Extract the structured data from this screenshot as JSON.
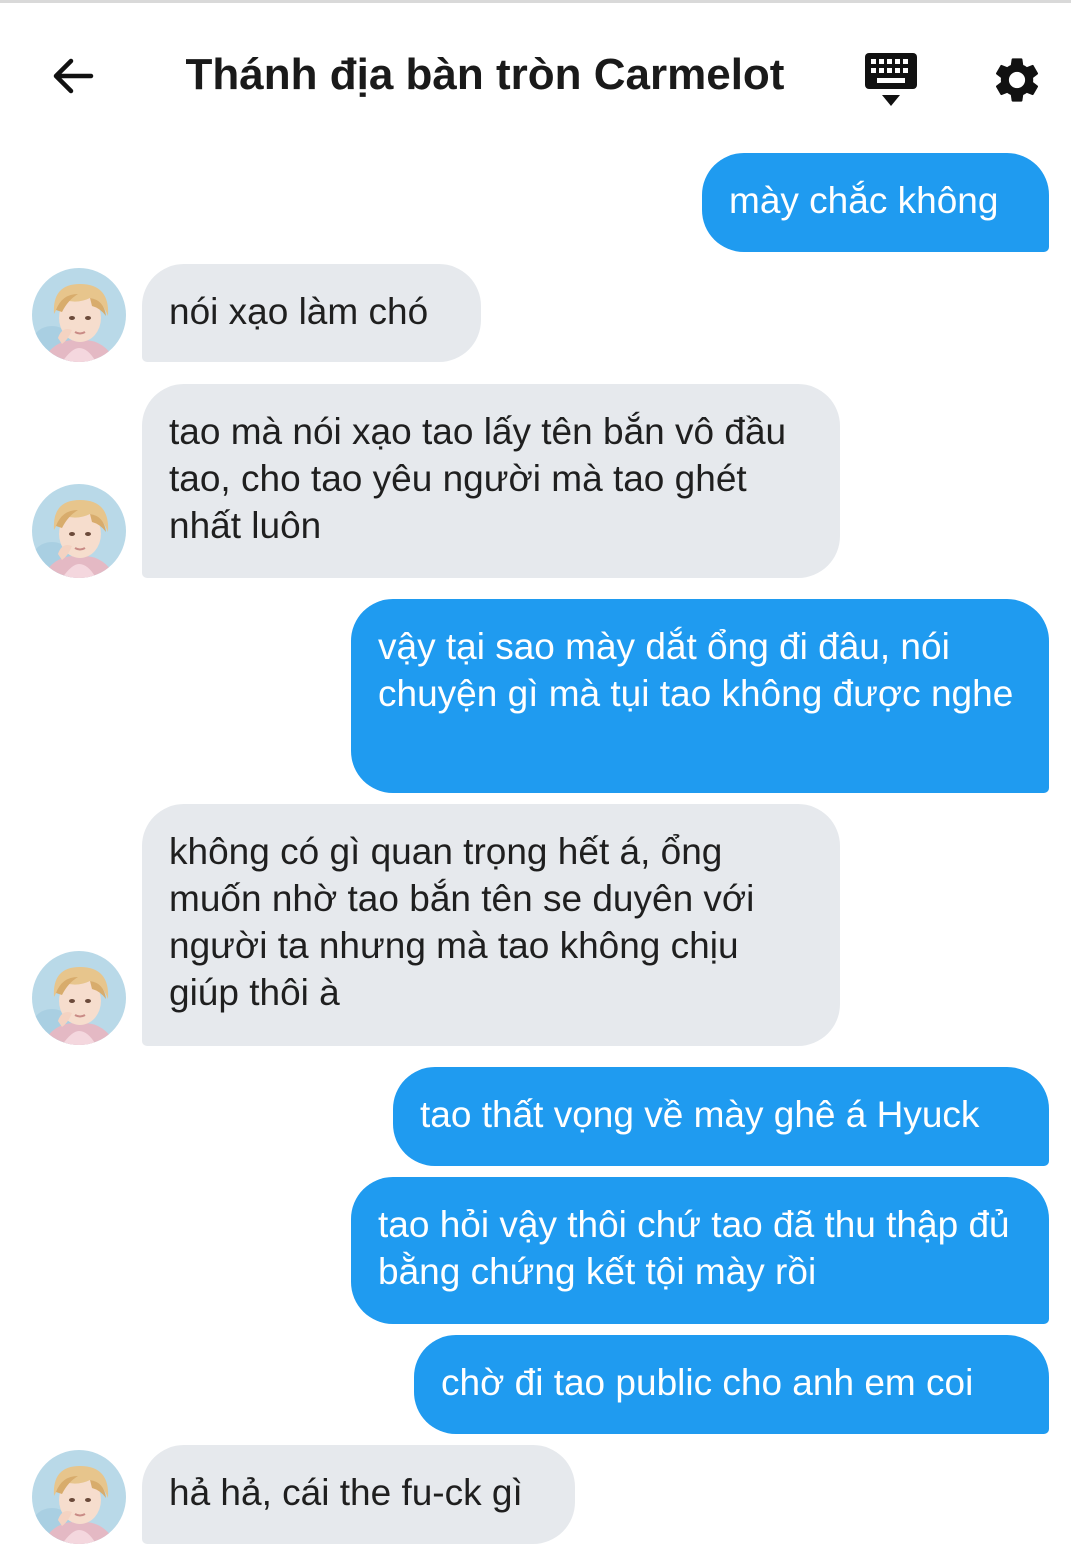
{
  "header": {
    "title": "Thánh địa bàn tròn Carmelot",
    "back_icon": "arrow-left-icon",
    "keyboard_icon": "keyboard-icon",
    "settings_icon": "gear-icon"
  },
  "colors": {
    "outgoing_bubble": "#1f9bf0",
    "incoming_bubble": "#e6e9ed"
  },
  "messages": [
    {
      "side": "out",
      "text": "mày chắc không"
    },
    {
      "side": "in",
      "text": "nói xạo làm chó"
    },
    {
      "side": "in",
      "text": "tao mà nói xạo tao lấy tên bắn vô đầu tao, cho tao yêu người mà tao ghét nhất luôn"
    },
    {
      "side": "out",
      "text": "vậy tại sao mày dắt ổng đi đâu, nói chuyện gì mà tụi tao không được nghe"
    },
    {
      "side": "in",
      "text": "không có gì quan trọng hết á, ổng muốn nhờ tao bắn tên se duyên với người ta nhưng mà tao không chịu giúp thôi à"
    },
    {
      "side": "out",
      "text": "tao thất vọng về mày ghê á Hyuck"
    },
    {
      "side": "out",
      "text": "tao hỏi vậy thôi chứ tao đã thu thập đủ bằng chứng kết tội mày rồi"
    },
    {
      "side": "out",
      "text": "chờ đi tao public cho anh em coi"
    },
    {
      "side": "in",
      "text": "hả hả, cái the fu-ck gì"
    }
  ]
}
